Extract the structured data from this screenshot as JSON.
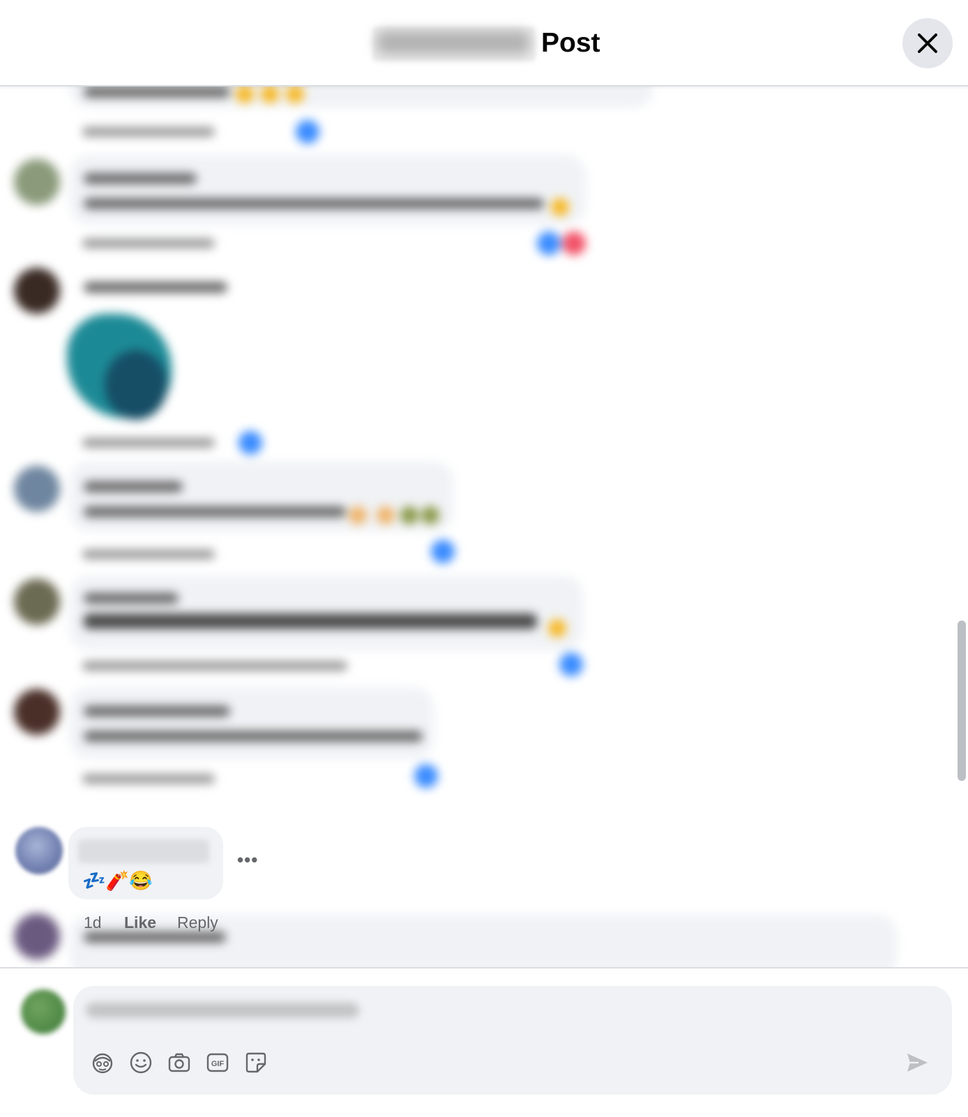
{
  "header": {
    "title": "Post",
    "close_label": "Close"
  },
  "highlighted_comment": {
    "emoji_text": "💤🧨😂",
    "more_label": "•••",
    "time": "1d",
    "like_label": "Like",
    "reply_label": "Reply"
  },
  "composer": {
    "tools": [
      "avatar-sticker-icon",
      "emoji-icon",
      "camera-icon",
      "gif-icon",
      "sticker-icon"
    ],
    "send_icon": "send-icon"
  },
  "colors": {
    "accent": "#1877f2",
    "bubble": "#f0f2f5",
    "secondary_text": "#65676b",
    "close_button": "#e4e6eb"
  }
}
